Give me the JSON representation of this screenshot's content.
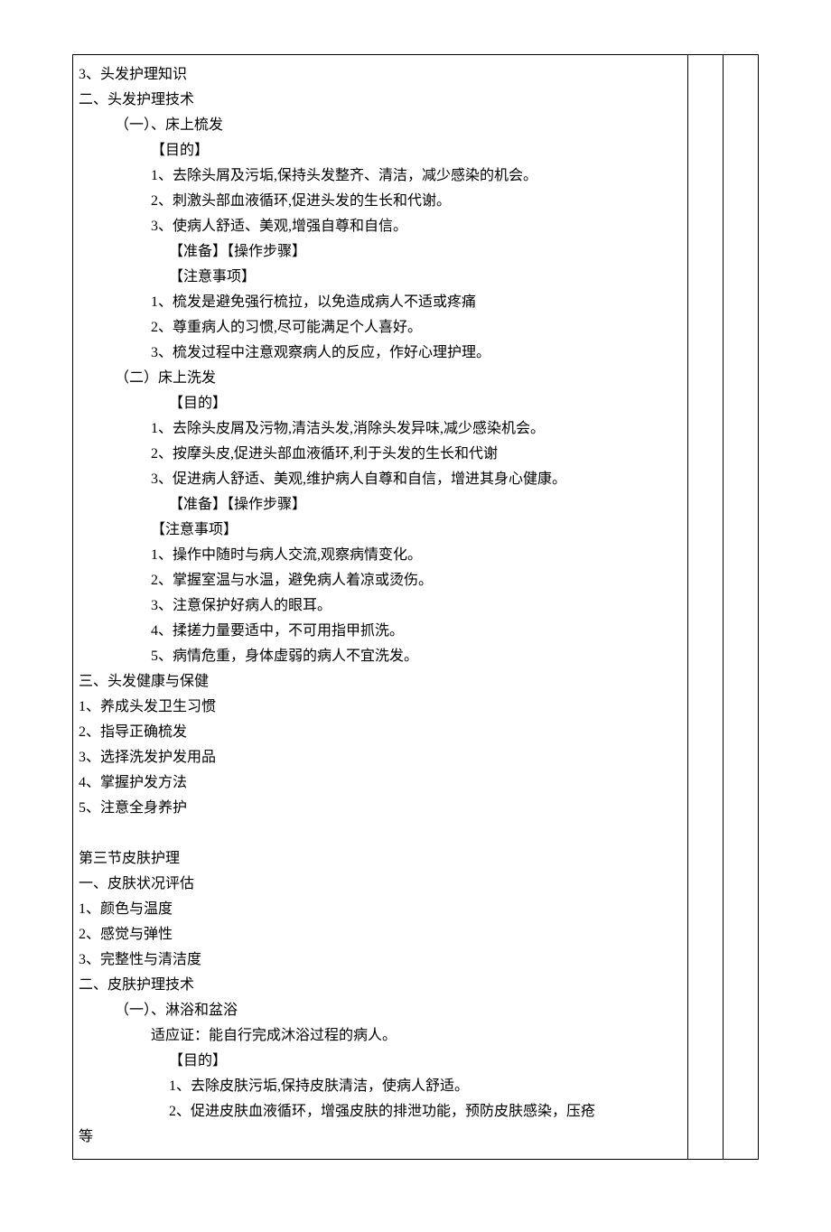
{
  "lines": [
    {
      "class": "ind0",
      "text": "3、头发护理知识"
    },
    {
      "class": "ind0",
      "text": "二、头发护理技术"
    },
    {
      "class": "ind1",
      "text": "（一）、床上梳发"
    },
    {
      "class": "ind2",
      "text": "【目的】"
    },
    {
      "class": "ind2",
      "text": "1、去除头屑及污垢,保持头发整齐、清洁，减少感染的机会。"
    },
    {
      "class": "ind2",
      "text": "2、刺激头部血液循环,促进头发的生长和代谢。"
    },
    {
      "class": "ind2",
      "text": "3、使病人舒适、美观,增强自尊和自信。"
    },
    {
      "class": "ind3",
      "text": "【准备】【操作步骤】"
    },
    {
      "class": "ind3",
      "text": "【注意事项】"
    },
    {
      "class": "ind2",
      "text": "1、梳发是避免强行梳拉，以免造成病人不适或疼痛"
    },
    {
      "class": "ind2",
      "text": "2、尊重病人的习惯,尽可能满足个人喜好。"
    },
    {
      "class": "ind2",
      "text": "3、梳发过程中注意观察病人的反应，作好心理护理。"
    },
    {
      "class": "ind1",
      "text": "（二）床上洗发"
    },
    {
      "class": "ind3",
      "text": "【目的】"
    },
    {
      "class": "ind2",
      "text": "1、去除头皮屑及污物,清洁头发,消除头发异味,减少感染机会。"
    },
    {
      "class": "ind2",
      "text": "2、按摩头皮,促进头部血液循环,利于头发的生长和代谢"
    },
    {
      "class": "ind2",
      "text": "3、促进病人舒适、美观,维护病人自尊和自信，增进其身心健康。"
    },
    {
      "class": "ind3",
      "text": "【准备】【操作步骤】"
    },
    {
      "class": "ind2",
      "text": "【注意事项】"
    },
    {
      "class": "ind2",
      "text": "1、操作中随时与病人交流,观察病情变化。"
    },
    {
      "class": "ind2",
      "text": "2、掌握室温与水温，避免病人着凉或烫伤。"
    },
    {
      "class": "ind2",
      "text": "3、注意保护好病人的眼耳。"
    },
    {
      "class": "ind2",
      "text": "4、揉搓力量要适中，不可用指甲抓洗。"
    },
    {
      "class": "ind2",
      "text": "5、病情危重，身体虚弱的病人不宜洗发。"
    },
    {
      "class": "ind0",
      "text": "三、头发健康与保健"
    },
    {
      "class": "ind0",
      "text": "1、养成头发卫生习惯"
    },
    {
      "class": "ind0",
      "text": "2、指导正确梳发"
    },
    {
      "class": "ind0",
      "text": "3、选择洗发护发用品"
    },
    {
      "class": "ind0",
      "text": "4、掌握护发方法"
    },
    {
      "class": "ind0",
      "text": "5、注意全身养护"
    },
    {
      "class": "blank",
      "text": ""
    },
    {
      "class": "ind0",
      "text": "第三节皮肤护理"
    },
    {
      "class": "ind0",
      "text": "一、皮肤状况评估"
    },
    {
      "class": "ind0",
      "text": "1、颜色与温度"
    },
    {
      "class": "ind0",
      "text": "2、感觉与弹性"
    },
    {
      "class": "ind0",
      "text": "3、完整性与清洁度"
    },
    {
      "class": "ind0",
      "text": "二、皮肤护理技术"
    },
    {
      "class": "ind1",
      "text": "（一）、淋浴和盆浴"
    },
    {
      "class": "ind2",
      "text": "适应证：能自行完成沐浴过程的病人。"
    },
    {
      "class": "ind3",
      "text": "【目的】"
    },
    {
      "class": "ind3",
      "text": "1、去除皮肤污垢,保持皮肤清洁，使病人舒适。"
    },
    {
      "class": "ind3",
      "text": "2、促进皮肤血液循环，增强皮肤的排泄功能，预防皮肤感染，压疮"
    },
    {
      "class": "ind0",
      "text": "等"
    }
  ]
}
